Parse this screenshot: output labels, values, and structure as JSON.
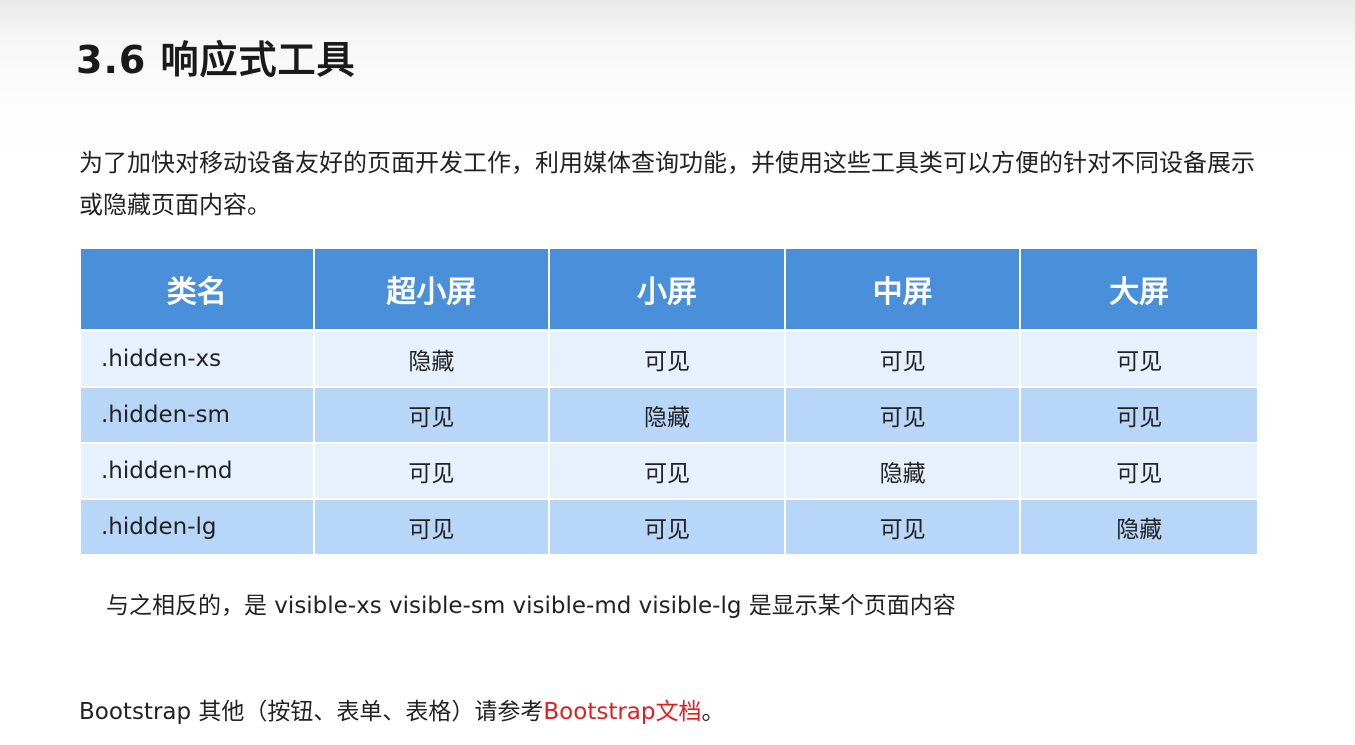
{
  "title": "3.6 响应式工具",
  "intro": "为了加快对移动设备友好的页面开发工作，利用媒体查询功能，并使用这些工具类可以方便的针对不同设备展示或隐藏页面内容。",
  "table": {
    "headers": [
      "类名",
      "超小屏",
      "小屏",
      "中屏",
      "大屏"
    ],
    "rows": [
      [
        ".hidden-xs",
        "隐藏",
        "可见",
        "可见",
        "可见"
      ],
      [
        ".hidden-sm",
        "可见",
        "隐藏",
        "可见",
        "可见"
      ],
      [
        ".hidden-md",
        "可见",
        "可见",
        "隐藏",
        "可见"
      ],
      [
        ".hidden-lg",
        "可见",
        "可见",
        "可见",
        "隐藏"
      ]
    ]
  },
  "note": "与之相反的，是 visible-xs visible-sm  visible-md visible-lg 是显示某个页面内容",
  "footer": {
    "prefix": "Bootstrap 其他（按钮、表单、表格）请参考",
    "link_text": "Bootstrap文档",
    "suffix": "。"
  },
  "colors": {
    "header_bg": "#4a8fd9",
    "row_light": "#e6f1fd",
    "row_dark": "#b8d6f7",
    "link": "#e02020"
  }
}
